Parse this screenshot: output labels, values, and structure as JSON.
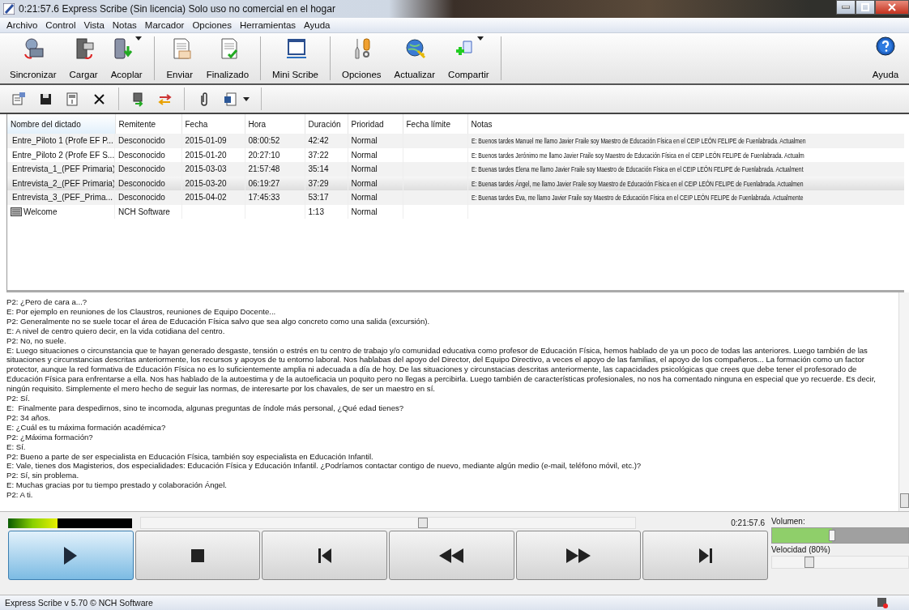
{
  "window": {
    "title": "0:21:57.6 Express Scribe (Sin licencia) Solo uso no comercial en el hogar"
  },
  "menu": [
    "Archivo",
    "Control",
    "Vista",
    "Notas",
    "Marcador",
    "Opciones",
    "Herramientas",
    "Ayuda"
  ],
  "toolbar": [
    {
      "label": "Sincronizar",
      "dropdown": false
    },
    {
      "label": "Cargar",
      "dropdown": false
    },
    {
      "label": "Acoplar",
      "dropdown": true
    },
    {
      "label": "Enviar",
      "dropdown": false
    },
    {
      "label": "Finalizado",
      "dropdown": false
    },
    {
      "label": "Mini Scribe",
      "dropdown": false
    },
    {
      "label": "Opciones",
      "dropdown": false
    },
    {
      "label": "Actualizar",
      "dropdown": false
    },
    {
      "label": "Compartir",
      "dropdown": true
    }
  ],
  "help": {
    "label": "Ayuda"
  },
  "table": {
    "columns": [
      "Nombre del dictado",
      "Remitente",
      "Fecha",
      "Hora",
      "Duración",
      "Prioridad",
      "Fecha límite",
      "Notas"
    ],
    "rows": [
      {
        "selected": false,
        "cells": [
          "Entre_Piloto 1 (Profe EF P...",
          "Desconocido",
          "2015-01-09",
          "08:00:52",
          "42:42",
          "Normal",
          "",
          "E: Buenos tardes Manuel me llamo Javier Fraile soy Maestro de Educación Física en el CEIP LEÓN FELIPE de Fuenlabrada. Actualmen"
        ]
      },
      {
        "selected": false,
        "cells": [
          "Entre_Piloto 2 (Profe EF S...",
          "Desconocido",
          "2015-01-20",
          "20:27:10",
          "37:22",
          "Normal",
          "",
          "E: Buenos tardes Jerónimo me llamo Javier Fraile soy Maestro de Educación Física en el CEIP LEÓN FELIPE de Fuenlabrada. Actualm"
        ]
      },
      {
        "selected": false,
        "cells": [
          "Entrevista_1_(PEF Primaria)",
          "Desconocido",
          "2015-03-03",
          "21:57:48",
          "35:14",
          "Normal",
          "",
          "E: Buenas tardes Elena me llamo Javier Fraile soy Maestro de Educación Física en el CEIP LEÓN FELIPE de Fuenlabrada. Actualment"
        ]
      },
      {
        "selected": true,
        "cells": [
          "Entrevista_2_(PEF Primaria)",
          "Desconocido",
          "2015-03-20",
          "06:19:27",
          "37:29",
          "Normal",
          "",
          "E: Buenas tardes Ángel, me llamo Javier Fraile soy Maestro de Educación Física en el CEIP LEÓN FELIPE de Fuenlabrada. Actualmen"
        ]
      },
      {
        "selected": false,
        "cells": [
          "Entrevista_3_(PEF_Prima...",
          "Desconocido",
          "2015-04-02",
          "17:45:33",
          "53:17",
          "Normal",
          "",
          "E: Buenas tardes Eva, me llamo Javier Fraile soy Maestro de Educación Física en el CEIP LEÓN FELIPE de Fuenlabrada. Actualmente"
        ]
      },
      {
        "selected": false,
        "cells": [
          "Welcome",
          "NCH Software",
          "",
          "",
          "1:13",
          "Normal",
          "",
          ""
        ]
      }
    ]
  },
  "transcript": [
    "P2: ¿Pero de cara a...?",
    "E: Por ejemplo en reuniones de los Claustros, reuniones de Equipo Docente...",
    "P2: Generalmente no se suele tocar el área de Educación Física salvo que sea algo concreto como una salida (excursión).",
    "E: A nivel de centro quiero decir, en la vida cotidiana del centro.",
    "P2: No, no suele.",
    "E: Luego situaciones o circunstancia que te hayan generado desgaste, tensión o estrés en tu centro de trabajo y/o comunidad educativa como profesor de Educación Física, hemos hablado de ya un poco de todas las anteriores. Luego también de las situaciones y circunstancias descritas anteriormente, los recursos y apoyos de tu entorno laboral. Nos hablabas del apoyo del Director, del Equipo Directivo, a veces el apoyo de las familias, el apoyo de los compañeros... La formación como un factor protector, aunque la red formativa de Educación Física no es lo suficientemente amplia ni adecuada a día de hoy. De las situaciones y circunstacias descritas anteriormente, las capacidades psicológicas que crees que debe tener el profesorado de Educación Física para enfrentarse a ella. Nos has hablado de la autoestima y de la autoeficacia un poquito pero no llegas a percibirla. Luego también de características profesionales, no nos ha comentado ninguna en especial que yo recuerde. Es decir, ningún requisito. Simplemente el mero hecho de seguir las normas, de interesarte por los chavales, de ser un maestro en sí.",
    "P2: Sí.",
    "E:  Finalmente para despedirnos, sino te incomoda, algunas preguntas de índole más personal, ¿Qué edad tienes?",
    "P2: 34 años.",
    "E: ¿Cuál es tu máxima formación académica?",
    "P2: ¿Máxima formación?",
    "E: Sí.",
    "P2: Bueno a parte de ser especialista en Educación Física, también soy especialista en Educación Infantil.",
    "E: Vale, tienes dos Magisterios, dos especialidades: Educación Física y Educación Infantil. ¿Podríamos contactar contigo de nuevo, mediante algún medio (e-mail, teléfono móvil, etc.)?",
    "P2: Sí, sin problema.",
    "E: Muchas gracias por tu tiempo prestado y colaboración Ángel.",
    "P2: A ti."
  ],
  "player": {
    "meter": {
      "level": 0.4
    },
    "position": {
      "level": 0.57
    },
    "time": "0:21:57.6",
    "buttons": [
      {
        "kind": "play",
        "selected": true
      },
      {
        "kind": "stop",
        "selected": false
      },
      {
        "kind": "start",
        "selected": false
      },
      {
        "kind": "rewind",
        "selected": false
      },
      {
        "kind": "forward",
        "selected": false
      },
      {
        "kind": "end",
        "selected": false
      }
    ],
    "volume": {
      "label": "Volumen:",
      "level": 0.44
    },
    "speed": {
      "label": "Velocidad (80%)",
      "level": 0.25
    }
  },
  "status_bar": {
    "text": "Express Scribe v 5.70 © NCH Software"
  }
}
